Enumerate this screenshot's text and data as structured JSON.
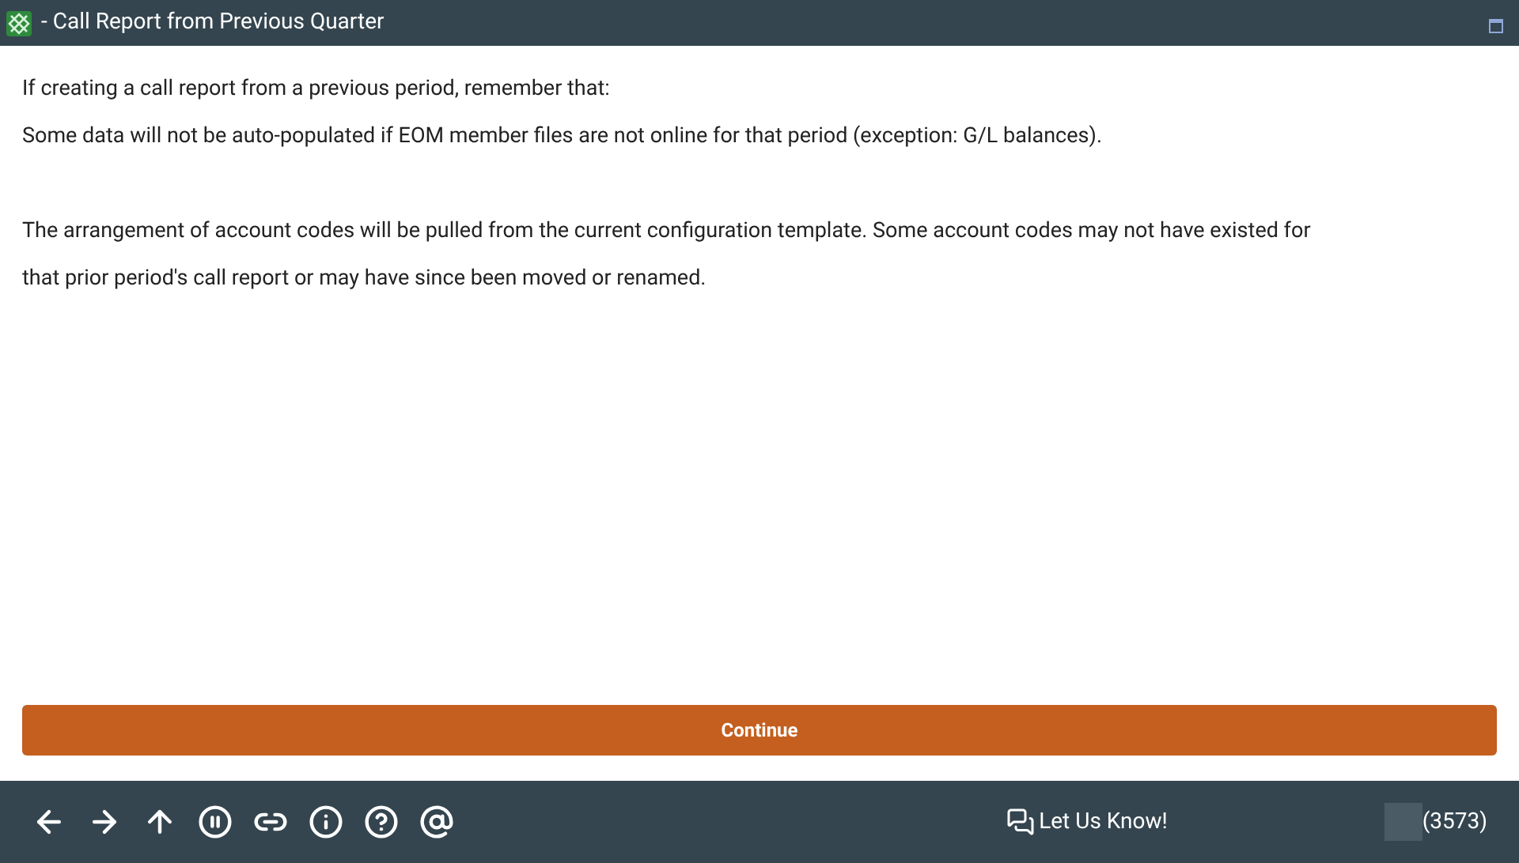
{
  "window": {
    "title": "- Call Report from Previous Quarter"
  },
  "paragraphs": [
    [
      "If creating a call report from a previous period, remember that:",
      "Some data will not be auto-populated if EOM member files are not online for that period (exception: G/L balances)."
    ],
    [
      "The arrangement of account codes will be pulled from the current configuration template. Some account codes may not have existed for",
      "that prior period's call report or may have since been moved or renamed."
    ]
  ],
  "continue_button": "Continue",
  "footer": {
    "feedback": "Let Us Know!",
    "user_code": "(3573)"
  }
}
